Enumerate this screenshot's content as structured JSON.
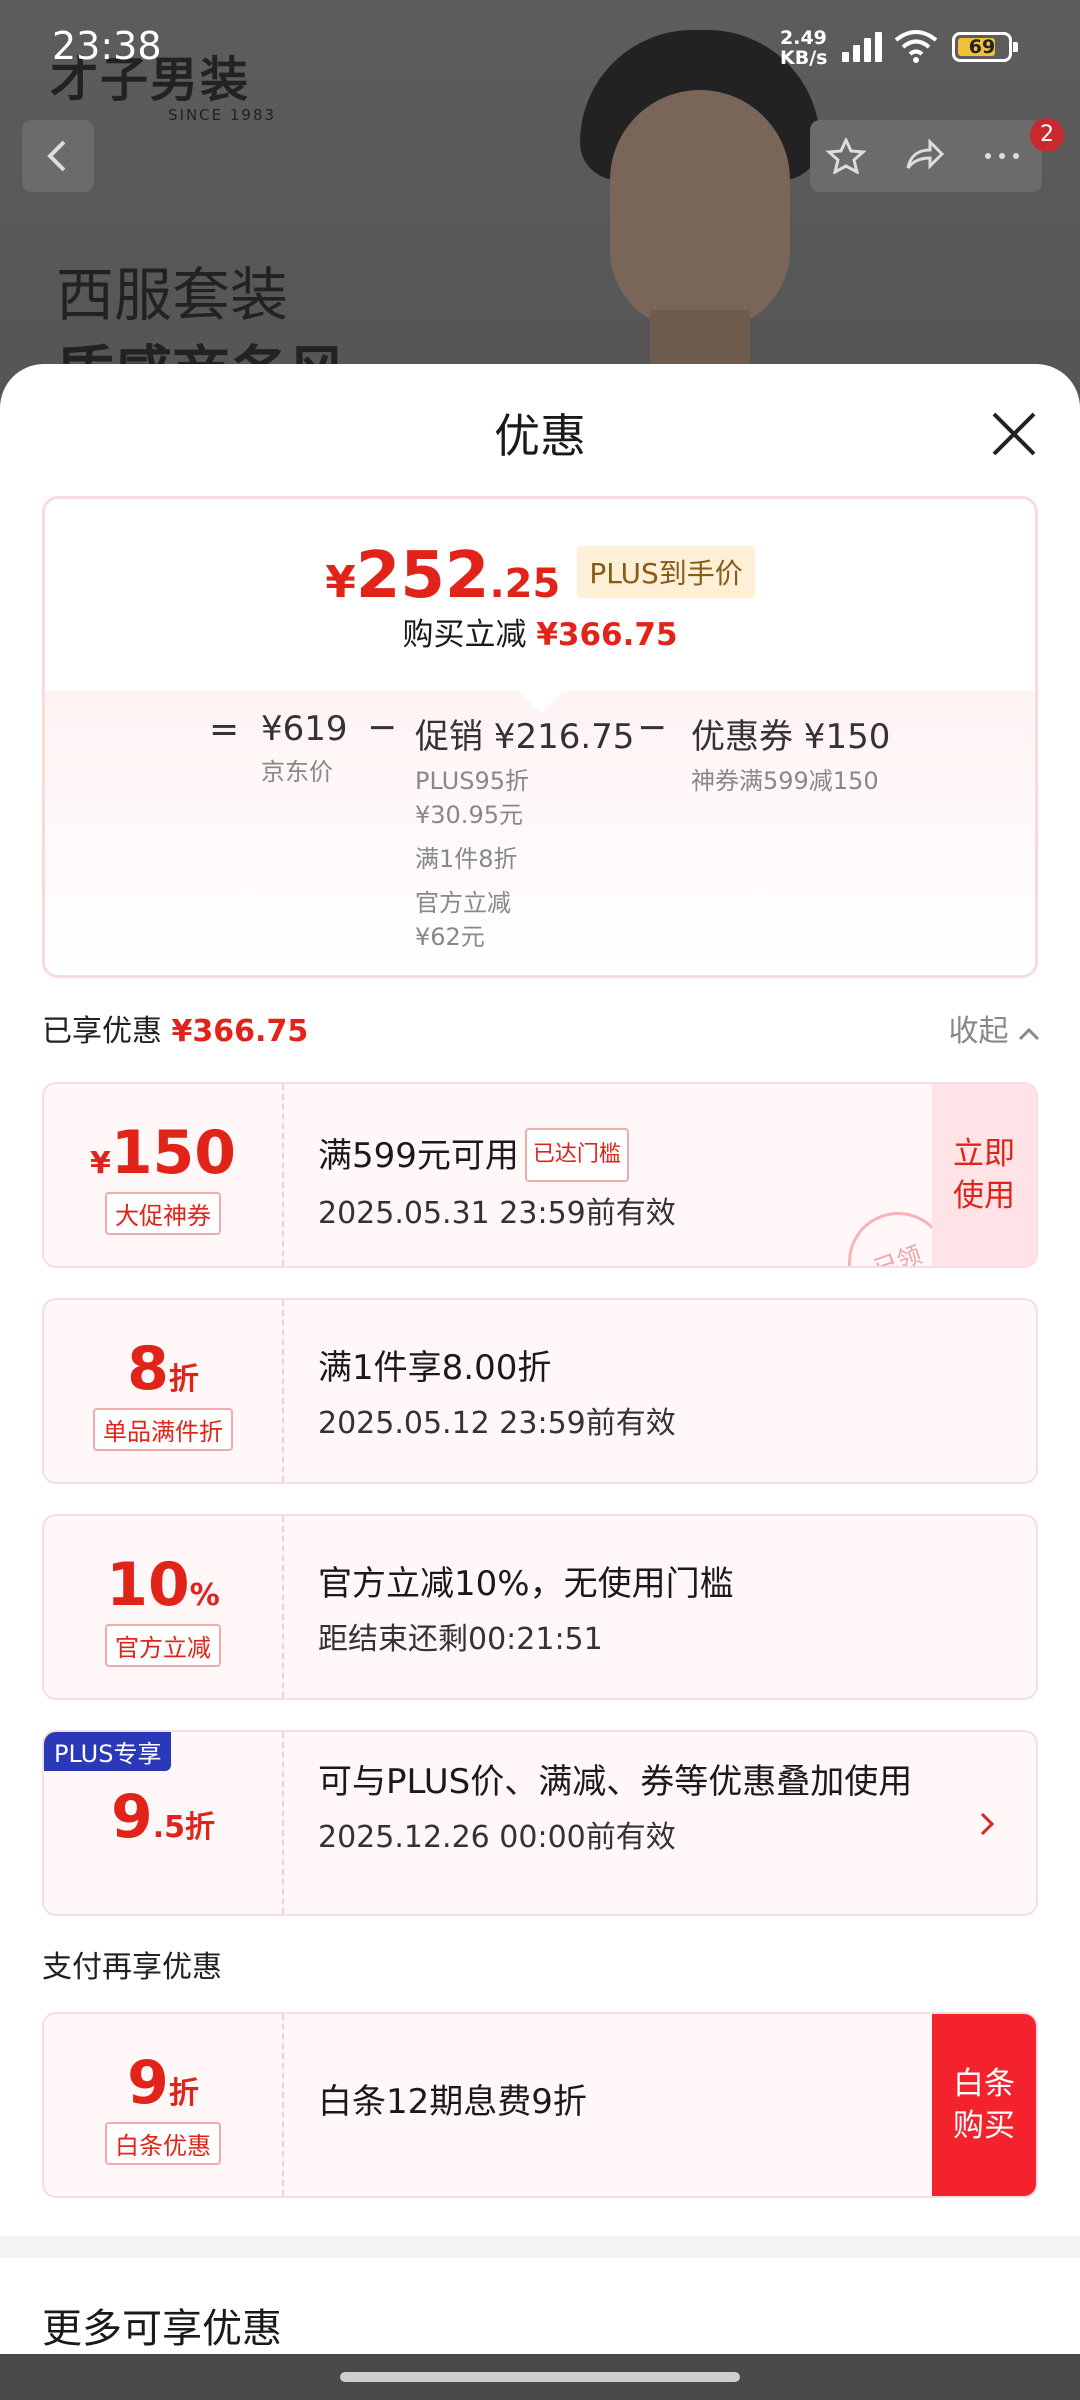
{
  "status_bar": {
    "time": "23:38",
    "network_speed": "2.49\nKB/s",
    "battery": "69"
  },
  "background": {
    "brand_logo": "才子男装",
    "brand_since": "SINCE 1983",
    "title_line1": "西服套装",
    "title_line2": "质感商务风",
    "notification_count": "2"
  },
  "sheet": {
    "title": "优惠",
    "summary": {
      "yen": "¥",
      "price_int": "252",
      "price_dec": ".25",
      "plus_tag": "PLUS到手价",
      "reduce_label": "购买立减",
      "reduce_amount": "¥366.75",
      "eq": "=",
      "minus": "−",
      "jd_price": "¥619",
      "jd_price_label": "京东价",
      "promo_title": "促销 ¥216.75",
      "promo_sub1": "PLUS95折",
      "promo_sub2": "¥30.95元",
      "promo_sub3": "满1件8折",
      "promo_sub4": "官方立减",
      "promo_sub5": "¥62元",
      "coupon_title": "优惠券 ¥150",
      "coupon_sub": "神券满599减150"
    },
    "enjoyed_label": "已享优惠",
    "enjoyed_amount": "¥366.75",
    "collapse_label": "收起",
    "cards": [
      {
        "yen": "¥",
        "value": "150",
        "tag": "大促神券",
        "line1": "满599元可用",
        "threshold": "已达门槛",
        "line2": "2025.05.31 23:59前有效",
        "cta": "立即\n使用",
        "stamp": "已领"
      },
      {
        "value": "8",
        "unit": "折",
        "tag": "单品满件折",
        "line1": "满1件享8.00折",
        "line2": "2025.05.12 23:59前有效"
      },
      {
        "value": "10",
        "unit": "%",
        "tag": "官方立减",
        "line1": "官方立减10%，无使用门槛",
        "line2": "距结束还剩00:21:51"
      },
      {
        "plus_label": "PLUS专享",
        "value": "9",
        "value_dec": ".5",
        "unit": "折",
        "line1": "可与PLUS价、满减、券等优惠叠加使用",
        "line2": "2025.12.26 00:00前有效"
      }
    ],
    "pay_section_title": "支付再享优惠",
    "pay_card": {
      "value": "9",
      "unit": "折",
      "tag": "白条优惠",
      "line1": "白条12期息费9折",
      "cta": "白条\n购买"
    },
    "more_title": "更多可享优惠"
  },
  "colors": {
    "accent_red": "#e2231a",
    "plus_blue": "#2a39b8",
    "cta_red": "#f4222d"
  }
}
